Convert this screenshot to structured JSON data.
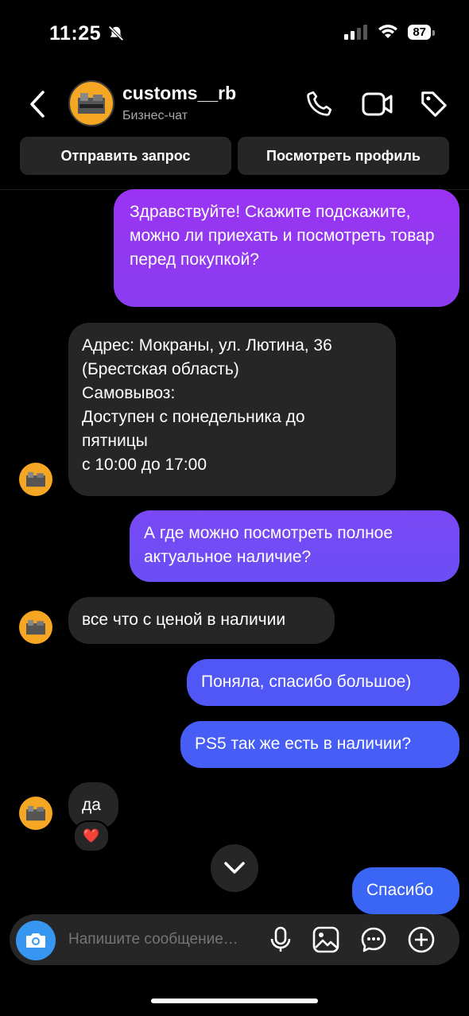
{
  "status_bar": {
    "time": "11:25",
    "battery": "87"
  },
  "header": {
    "username": "customs__rb",
    "subtitle": "Бизнес-чат"
  },
  "actions": {
    "send_request": "Отправить запрос",
    "view_profile": "Посмотреть профиль"
  },
  "messages": [
    {
      "from": "me",
      "text": "Здравствуйте! Скажите подскажите, можно ли приехать и посмотреть товар перед покупкой?"
    },
    {
      "from": "them",
      "lines": [
        "Адрес: Мокраны, ул. Лютина, 36",
        "(Брестская область)",
        "Самовывоз:",
        "Доступен с понедельника до",
        "пятницы",
        "с 10:00 до 17:00"
      ]
    },
    {
      "from": "me",
      "text": "А где можно посмотреть полное актуальное наличие?"
    },
    {
      "from": "them",
      "text": "все что с ценой в наличии"
    },
    {
      "from": "me",
      "text": "Поняла, спасибо большое)"
    },
    {
      "from": "me",
      "text": "PS5 так же есть в наличии?"
    },
    {
      "from": "them",
      "text": "да",
      "reaction": "❤️"
    },
    {
      "from": "me",
      "text": "Спасибо"
    }
  ],
  "composer": {
    "placeholder": "Напишите сообщение…"
  },
  "colors": {
    "bg": "#000000",
    "incoming": "#262626",
    "accent": "#3797f0",
    "gradient_top": "#a033f0",
    "gradient_bottom": "#3b5ef5"
  }
}
